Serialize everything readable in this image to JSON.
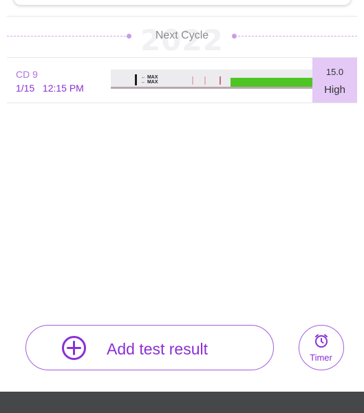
{
  "cycle_divider": {
    "label": "Next Cycle",
    "year": "2022"
  },
  "entries": [
    {
      "cycle_day": "CD 9",
      "date": "1/15",
      "time": "12:15 PM",
      "strip_markings": [
        "MAX",
        "MAX"
      ],
      "score": "15.0",
      "level": "High"
    }
  ],
  "actions": {
    "add_label": "Add test result",
    "timer_label": "Timer"
  },
  "icons": {
    "add": "plus-circle-icon",
    "timer": "alarm-clock-icon"
  },
  "colors": {
    "accent": "#8a2fd6",
    "level_highlight": "#e4c9f6",
    "bottom_bar": "#454749"
  }
}
